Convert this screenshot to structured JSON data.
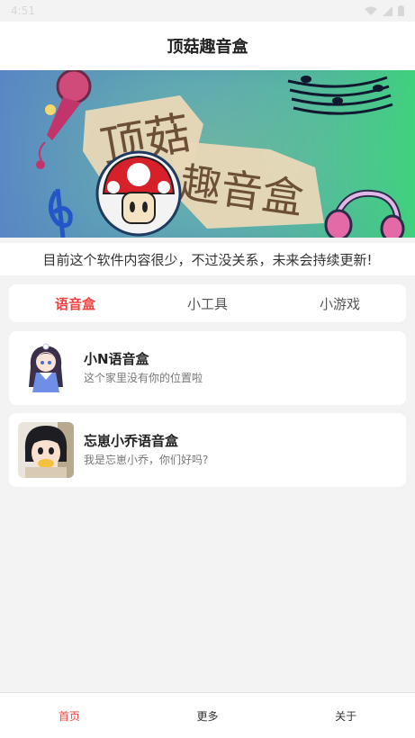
{
  "status_bar": {
    "time": "4:51"
  },
  "header": {
    "title": "顶菇趣音盒"
  },
  "banner": {
    "title_line1": "顶菇",
    "title_line2": "趣音盒"
  },
  "notice": {
    "text": "目前这个软件内容很少，不过没关系，未来会持续更新!"
  },
  "tabs": [
    {
      "label": "语音盒"
    },
    {
      "label": "小工具"
    },
    {
      "label": "小游戏"
    }
  ],
  "cards": [
    {
      "title": "小N语音盒",
      "subtitle": "这个家里没有你的位置啦"
    },
    {
      "title": "忘崽小乔语音盒",
      "subtitle": "我是忘崽小乔，你们好吗?"
    }
  ],
  "bottom_nav": [
    {
      "label": "首页"
    },
    {
      "label": "更多"
    },
    {
      "label": "关于"
    }
  ],
  "colors": {
    "accent": "#f0413f",
    "background": "#f3f3f3",
    "card": "#ffffff"
  }
}
